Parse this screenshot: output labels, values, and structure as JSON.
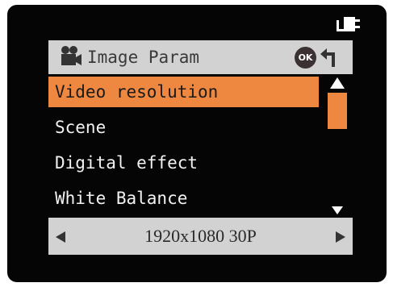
{
  "header": {
    "title": "Image Param",
    "ok_label": "OK"
  },
  "menu": {
    "items": [
      {
        "label": "Video resolution",
        "selected": true
      },
      {
        "label": "Scene",
        "selected": false
      },
      {
        "label": "Digital effect",
        "selected": false
      },
      {
        "label": "White Balance",
        "selected": false
      }
    ]
  },
  "value_selector": {
    "value": "1920x1080 30P"
  },
  "colors": {
    "screen_background": "#050505",
    "bar_background": "#d2d2d2",
    "highlight": "#ee8840",
    "ok_badge": "#3b3032",
    "menu_text": "#f2f2f2"
  },
  "icons": {
    "status": "power-plug-icon",
    "header": "movie-camera-icon",
    "back": "back-return-icon",
    "scroll_up": "triangle-up-icon",
    "scroll_down": "triangle-down-icon",
    "prev": "triangle-left-icon",
    "next": "triangle-right-icon"
  }
}
